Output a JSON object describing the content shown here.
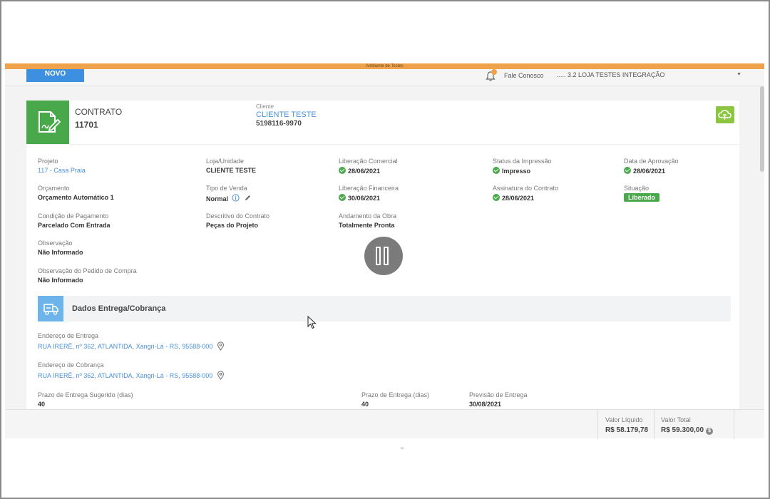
{
  "env_label": "Ambiente de Testes",
  "topbar": {
    "new_button": "NOVO",
    "contact_label": "Fale Conosco",
    "store_label": "..... 3.2 LOJA TESTES INTEGRAÇÃO",
    "notification_icon": "bell-icon"
  },
  "contract": {
    "label": "CONTRATO",
    "number": "11701",
    "client_label": "Cliente",
    "client_name": "CLIENTE TESTE",
    "client_phone": "5198116-9970"
  },
  "fields": {
    "projeto": {
      "label": "Projeto",
      "value": "117 - Casa Praia"
    },
    "loja": {
      "label": "Loja/Unidade",
      "value": "CLIENTE TESTE"
    },
    "lib_comercial": {
      "label": "Liberação Comercial",
      "value": "28/06/2021"
    },
    "status_impressao": {
      "label": "Status da Impressão",
      "value": "Impresso"
    },
    "data_aprovacao": {
      "label": "Data de Aprovação",
      "value": "28/06/2021"
    },
    "orcamento": {
      "label": "Orçamento",
      "value": "Orçamento Automático 1"
    },
    "tipo_venda": {
      "label": "Tipo de Venda",
      "value": "Normal"
    },
    "lib_financeira": {
      "label": "Liberação Financeira",
      "value": "30/06/2021"
    },
    "assinatura": {
      "label": "Assinatura do Contrato",
      "value": "28/06/2021"
    },
    "situacao": {
      "label": "Situação",
      "value": "Liberado"
    },
    "condicao": {
      "label": "Condição de Pagamento",
      "value": "Parcelado Com Entrada"
    },
    "descritivo": {
      "label": "Descritivo do Contrato",
      "value": "Peças do Projeto"
    },
    "andamento": {
      "label": "Andamento da Obra",
      "value": "Totalmente Pronta"
    },
    "observacao": {
      "label": "Observação",
      "value": "Não Informado"
    },
    "obs_pedido": {
      "label": "Observação do Pedido de Compra",
      "value": "Não Informado"
    }
  },
  "delivery": {
    "section_title": "Dados Entrega/Cobrança",
    "entrega_label": "Endereço de Entrega",
    "entrega_value": "RUA IRERÊ, nº 362, ATLANTIDA, Xangri-Lá - RS, 95588-000",
    "cobranca_label": "Endereço de Cobrança",
    "cobranca_value": "RUA IRERÊ, nº 362, ATLANTIDA, Xangri-Lá - RS, 95588-000",
    "prazo_sugerido_label": "Prazo de Entrega Sugerido (dias)",
    "prazo_sugerido_value": "40",
    "prazo_label": "Prazo de Entrega (dias)",
    "prazo_value": "40",
    "previsao_label": "Previsão de Entrega",
    "previsao_value": "30/08/2021"
  },
  "totals": {
    "liquido_label": "Valor Líquido",
    "liquido_value": "R$ 58.179,78",
    "total_label": "Valor Total",
    "total_value": "R$ 59.300,00"
  },
  "colors": {
    "accent_green": "#49a84a",
    "accent_blue": "#3d8fe0",
    "env_orange": "#f0a24a"
  }
}
